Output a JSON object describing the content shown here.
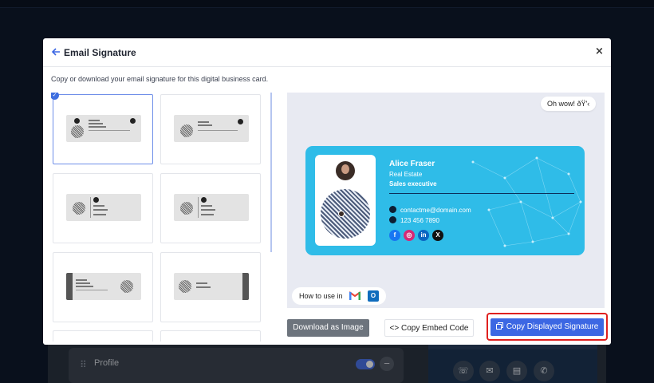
{
  "background": {
    "profile_label": "Profile",
    "drag_icon": "drag-handle-icon",
    "action_icons": [
      "phone-icon",
      "mail-icon",
      "message-icon",
      "whatsapp-icon"
    ]
  },
  "modal": {
    "title": "Email Signature",
    "subtitle": "Copy or download your email signature for this digital business card.",
    "close_icon": "×",
    "back_icon": "arrow-left-icon"
  },
  "templates": {
    "selected_index": 0,
    "count_visible": 8,
    "mini_labels": [
      "Name",
      "Job Title",
      "Company Name"
    ]
  },
  "preview": {
    "bubble_text": "Oh wow! ðŸ'‹",
    "signature": {
      "name": "Alice Fraser",
      "role": "Real Estate",
      "title": "Sales executive",
      "email": "contactme@domain.com",
      "phone": "123 456 7890",
      "socials": [
        {
          "name": "facebook-icon",
          "glyph": "f",
          "color": "#1877f2"
        },
        {
          "name": "instagram-icon",
          "glyph": "◎",
          "color": "#d62976"
        },
        {
          "name": "linkedin-icon",
          "glyph": "in",
          "color": "#0a66c2"
        },
        {
          "name": "x-icon",
          "glyph": "X",
          "color": "#111111"
        }
      ],
      "background_color": "#2fbce8"
    },
    "howto_label": "How to use in",
    "clients": [
      "gmail-icon",
      "outlook-icon"
    ],
    "outlook_glyph": "O"
  },
  "footer": {
    "download_label": "Download as Image",
    "embed_label": "<> Copy Embed Code",
    "copy_label": "Copy Displayed Signature",
    "accent": "#3c67e3",
    "highlight": "#e0201f"
  }
}
